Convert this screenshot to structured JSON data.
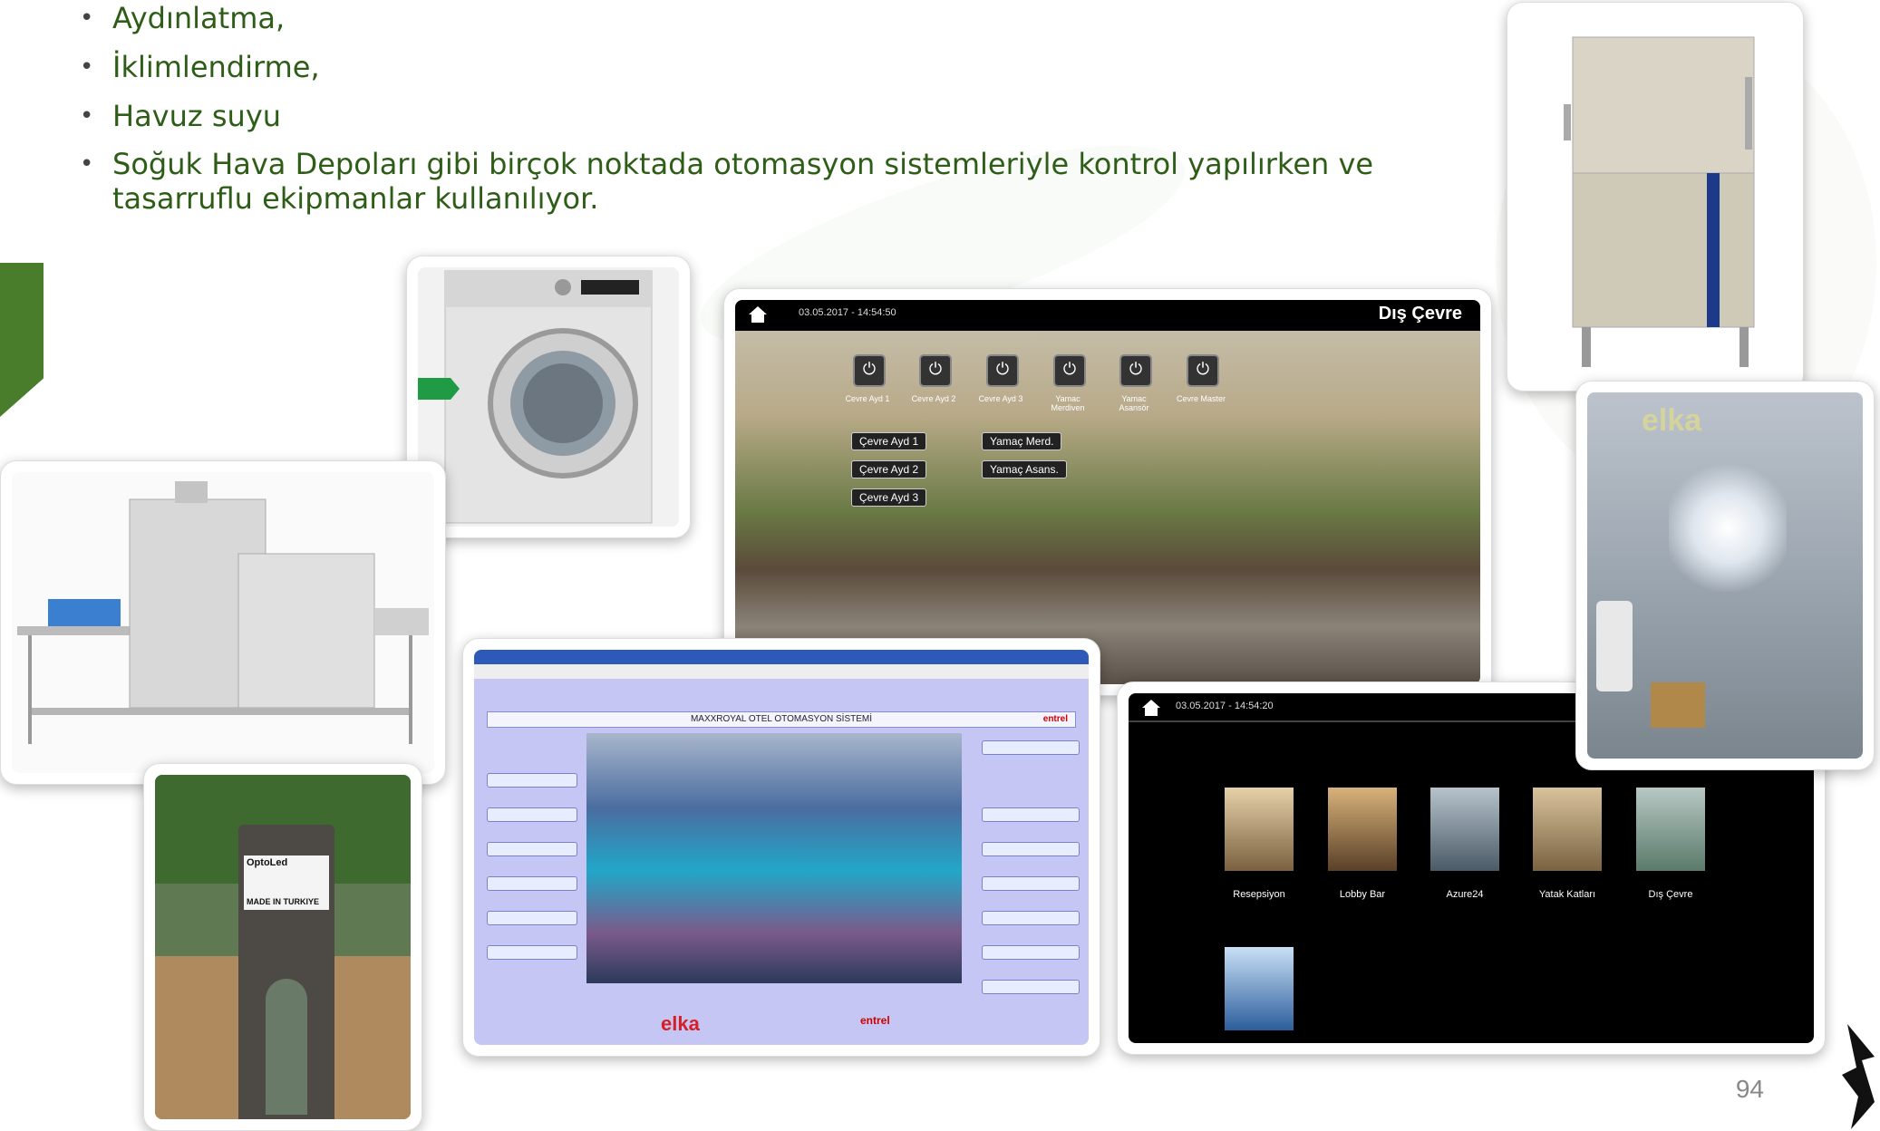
{
  "bullets": [
    "Aydınlatma,",
    "İklimlendirme,",
    "Havuz suyu",
    "Soğuk Hava Depoları gibi birçok noktada otomasyon sistemleriyle kontrol yapılırken ve tasarruflu ekipmanlar kullanılıyor."
  ],
  "bullet_symbol": "•",
  "screen1": {
    "time": "03.05.2017 - 14:54:50",
    "title": "Dış Çevre",
    "power_labels": [
      "Cevre Ayd 1",
      "Cevre Ayd 2",
      "Cevre Ayd 3",
      "Yamac Merdiven",
      "Yamac Asansör",
      "Cevre Master"
    ],
    "switch_labels": [
      "Çevre Ayd 1",
      "Çevre Ayd 2",
      "Çevre Ayd 3",
      "Yamaç Merd.",
      "Yamaç Asans."
    ]
  },
  "screen2": {
    "time": "03.05.2017 - 14:54:20",
    "thumbs": [
      "Resepsiyon",
      "Lobby Bar",
      "Azure24",
      "Yatak Katları",
      "Dış Çevre"
    ]
  },
  "screen3": {
    "header": "MAXXROYAL OTEL OTOMASYON SİSTEMİ",
    "brand": "entrel",
    "logo": "elka"
  },
  "sensor_label": {
    "brand": "OptoLed",
    "made_in": "MADE IN TURKIYE"
  },
  "page_number": "94",
  "colors": {
    "green": "#2e5d17",
    "accent_bar": "#4a7d2b"
  }
}
